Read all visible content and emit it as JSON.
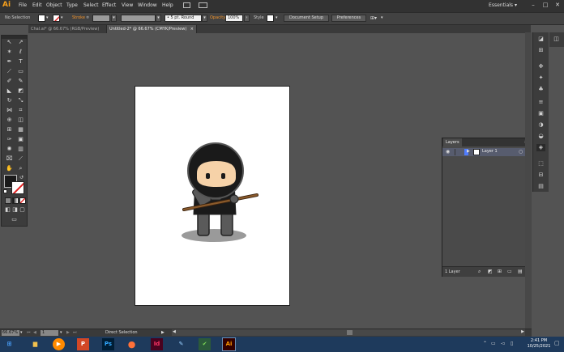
{
  "app": {
    "logo": "Ai",
    "workspace": "Essentials",
    "workspace_chevron": "▾"
  },
  "menu": [
    "File",
    "Edit",
    "Object",
    "Type",
    "Select",
    "Effect",
    "View",
    "Window",
    "Help"
  ],
  "window_buttons": [
    "–",
    "□",
    "✕"
  ],
  "control_bar": {
    "selection": "No Selection",
    "stroke_label": "Stroke",
    "stroke_unit": "≑",
    "brush": "• 5 pt. Round",
    "opacity_label": "Opacity",
    "opacity_value": "100%",
    "style_label": "Style",
    "doc_setup": "Document Setup",
    "preferences": "Preferences"
  },
  "tabs": [
    {
      "label": "Chal.ai* @ 66.67% (RGB/Preview)",
      "close": "×",
      "active": false
    },
    {
      "label": "Untitled-2* @ 66.67% (CMYK/Preview)",
      "close": "×",
      "active": true
    }
  ],
  "layers_panel": {
    "tab": "Layers",
    "layer_name": "Layer 1",
    "count": "1 Layer"
  },
  "status": {
    "zoom": "66.67%",
    "page": "1",
    "tool": "Direct Selection"
  },
  "taskbar": {
    "apps": [
      {
        "name": "start",
        "glyph": "⊞",
        "color": "#4aa3ff"
      },
      {
        "name": "explorer",
        "glyph": "▆",
        "color": "#f2c14e"
      },
      {
        "name": "media",
        "glyph": "▶",
        "color": "#ff8a00"
      },
      {
        "name": "powerpoint",
        "glyph": "P",
        "color": "#d24726"
      },
      {
        "name": "photoshop",
        "glyph": "Ps",
        "color": "#31a8ff"
      },
      {
        "name": "firefox",
        "glyph": "●",
        "color": "#ff7139"
      },
      {
        "name": "indesign",
        "glyph": "Id",
        "color": "#ff3366"
      },
      {
        "name": "paint",
        "glyph": "✎",
        "color": "#9ad0ff"
      },
      {
        "name": "green-app",
        "glyph": "✔",
        "color": "#7ed957"
      },
      {
        "name": "illustrator",
        "glyph": "Ai",
        "color": "#ff9a00"
      }
    ],
    "time": "2:41 PM",
    "date": "10/25/2021"
  }
}
